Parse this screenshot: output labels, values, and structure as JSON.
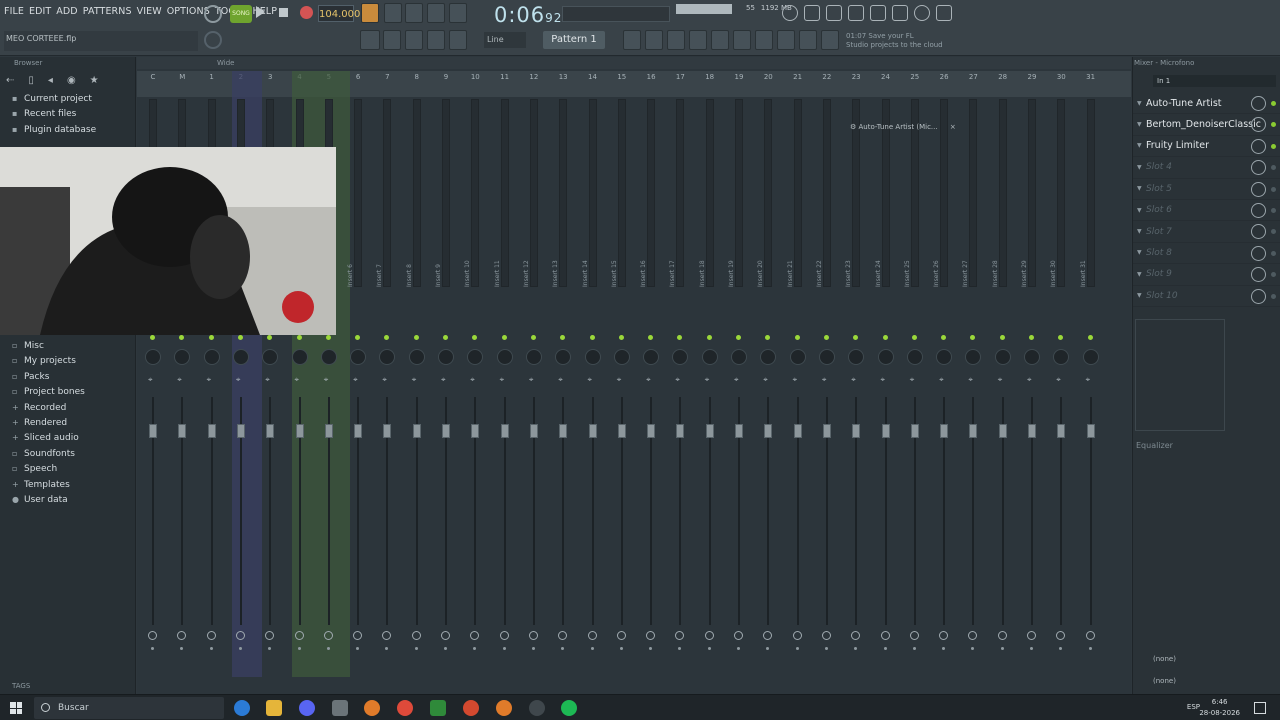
{
  "menu": [
    "FILE",
    "EDIT",
    "ADD",
    "PATTERNS",
    "VIEW",
    "OPTIONS",
    "TOOLS",
    "HELP"
  ],
  "project_name": "MEO CORTEEE.flp",
  "transport": {
    "song_label": "SONG",
    "tempo": "104.000",
    "time": "0:06",
    "time_fraction": "92",
    "pattern": "Pattern 1",
    "snap": "Line",
    "memory": "1192 MB",
    "cpu": "55",
    "voices": "0"
  },
  "hint": {
    "line1": "01:07 Save your FL",
    "line2": "Studio projects to the cloud"
  },
  "browser": {
    "title": "Browser",
    "top_items": [
      "Current project",
      "Recent files",
      "Plugin database"
    ],
    "items": [
      "Misc",
      "My projects",
      "Packs",
      "Project bones",
      "Recorded",
      "Rendered",
      "Sliced audio",
      "Soundfonts",
      "Speech",
      "Templates",
      "User data"
    ],
    "tags_label": "TAGS"
  },
  "mixer": {
    "title": "Wide",
    "channel_numbers": [
      "C",
      "M",
      "1",
      "2",
      "3",
      "4",
      "5",
      "6",
      "7",
      "8",
      "9",
      "10",
      "11",
      "12",
      "13",
      "14",
      "15",
      "16",
      "17",
      "18",
      "19",
      "20",
      "21",
      "22",
      "23",
      "24",
      "25",
      "26",
      "27",
      "28",
      "29",
      "30",
      "31"
    ],
    "insert_labels": [
      "Insert 6",
      "Insert 7",
      "Insert 8",
      "Insert 9",
      "Insert 10",
      "Insert 11",
      "Insert 12",
      "Insert 13",
      "Insert 14",
      "Insert 15",
      "Insert 16",
      "Insert 17",
      "Insert 18",
      "Insert 19",
      "Insert 20",
      "Insert 21",
      "Insert 22",
      "Insert 23",
      "Insert 24",
      "Insert 25",
      "Insert 26",
      "Insert 27",
      "Insert 28",
      "Insert 29",
      "Insert 30",
      "Insert 31"
    ],
    "floating_plugin": "Auto-Tune Artist (Mic..."
  },
  "fx_panel": {
    "title": "Mixer - Microfono",
    "input": "In 1",
    "slots": [
      {
        "name": "Auto-Tune Artist",
        "active": true
      },
      {
        "name": "Bertom_DenoiserClassic",
        "active": true
      },
      {
        "name": "Fruity Limiter",
        "active": true
      },
      {
        "name": "Slot 4",
        "active": false
      },
      {
        "name": "Slot 5",
        "active": false
      },
      {
        "name": "Slot 6",
        "active": false
      },
      {
        "name": "Slot 7",
        "active": false
      },
      {
        "name": "Slot 8",
        "active": false
      },
      {
        "name": "Slot 9",
        "active": false
      },
      {
        "name": "Slot 10",
        "active": false
      }
    ],
    "eq_label": "Equalizer",
    "route_in": "(none)",
    "route_out": "(none)"
  },
  "taskbar": {
    "search_placeholder": "Buscar",
    "lang": "ESP",
    "time": "6:46",
    "date": "28-08-2026"
  },
  "colors": {
    "accent_green": "#9bd83a",
    "record_red": "#d45454",
    "tempo_orange": "#e6c36a"
  }
}
